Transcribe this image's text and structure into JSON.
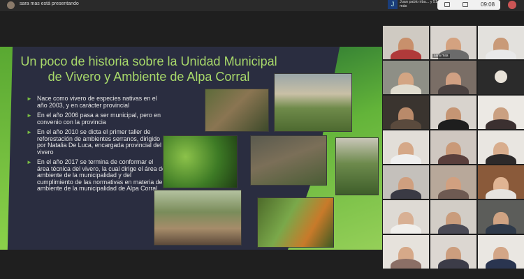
{
  "topbar": {
    "presenting_text": "sara mas está presentando",
    "participant_badge": "J",
    "participant_name": "Juan pablo irba... y 51 más",
    "clock": "09:08"
  },
  "slide": {
    "title": "Un poco de historia sobre la Unidad Municipal de Vivero y Ambiente de Alpa Corral",
    "bullets": [
      "Nace como vivero de especies nativas en el año 2003, y en carácter provincial",
      "En el año 2006 pasa a ser municipal, pero en convenio con la provincia",
      "En el año 2010 se dicta el primer taller de reforestación de ambientes serranos, dirigido por Natalia De Luca, encargada provincial del vivero",
      "En el año 2017 se termina de conformar el área técnica del vivero, la cual dirige el área de ambiente de la municipalidad y del cumplimiento de las normativas en materia de ambiente de la municipalidad de Alpa Corral"
    ]
  },
  "participants": {
    "self_label": "sara mas"
  },
  "colors": {
    "accent_green": "#a8d96a",
    "slide_bg": "#2a2d40",
    "badge_blue": "#1a3d7a"
  }
}
